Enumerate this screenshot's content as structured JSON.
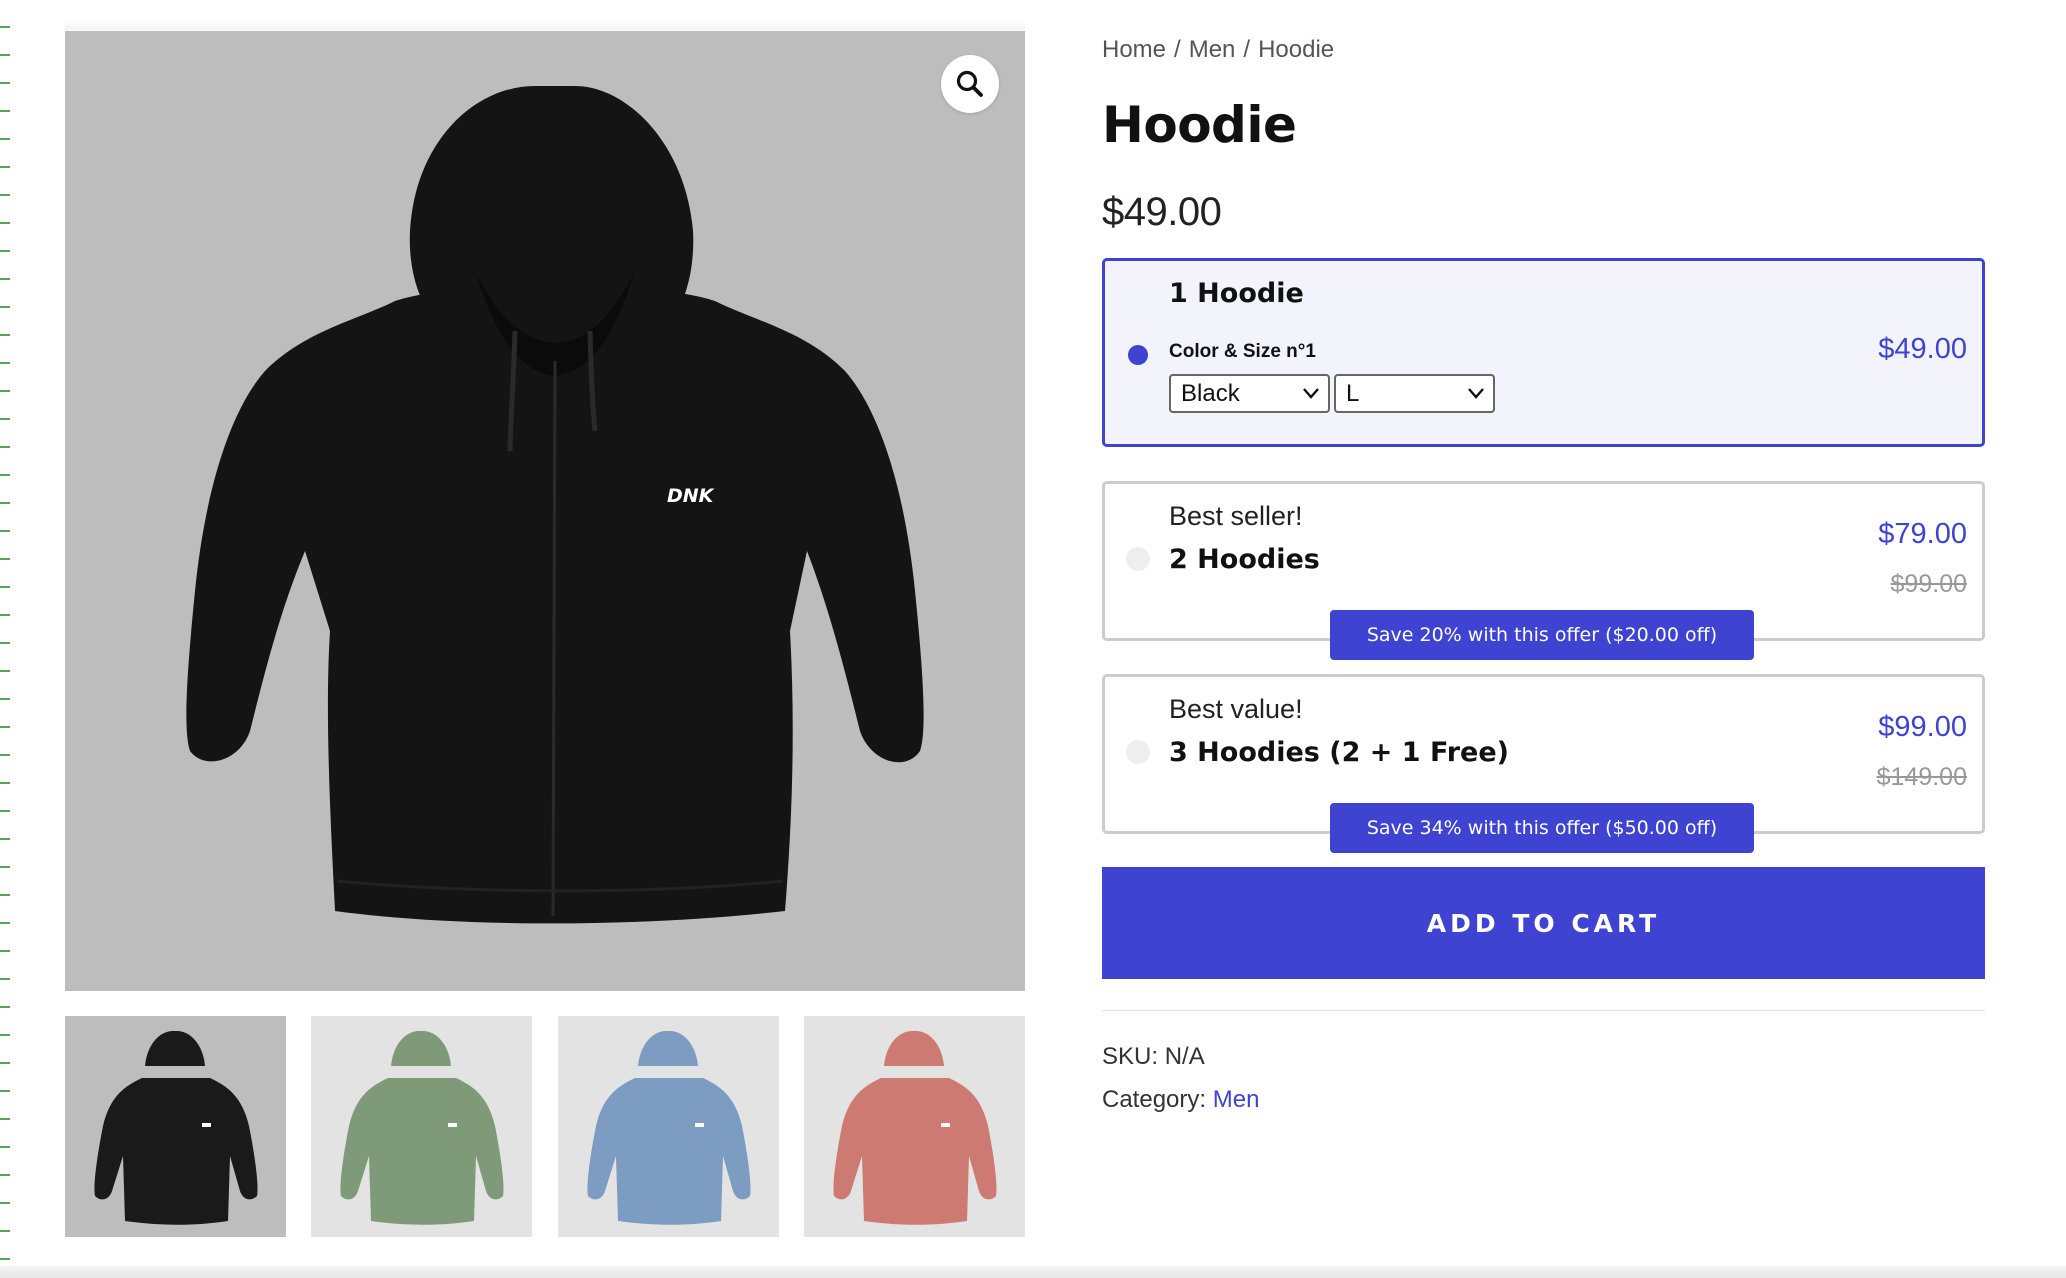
{
  "breadcrumb": {
    "items": [
      "Home",
      "Men",
      "Hoodie"
    ],
    "separator": "/"
  },
  "product": {
    "title": "Hoodie",
    "price": "$49.00"
  },
  "gallery": {
    "main_image": "black hoodie",
    "zoom_icon": "magnifier-icon",
    "thumbnails": [
      {
        "label": "black hoodie",
        "color": "#1a1a1a",
        "bg": "#bdbdbd"
      },
      {
        "label": "green hoodie",
        "color": "#7f9a78",
        "bg": "#e3e3e3"
      },
      {
        "label": "blue hoodie",
        "color": "#7c9cc1",
        "bg": "#e3e3e3"
      },
      {
        "label": "red hoodie",
        "color": "#cc7a72",
        "bg": "#e3e3e3"
      }
    ],
    "logo_text": "DNK"
  },
  "offers": [
    {
      "name": "1 Hoodie",
      "variant_label": "Color & Size n°1",
      "color_select": "Black",
      "size_select": "L",
      "price": "$49.00",
      "selected": true
    },
    {
      "tag": "Best seller!",
      "name": "2 Hoodies",
      "price": "$79.00",
      "old_price": "$99.00",
      "save_text": "Save 20% with this offer ($20.00 off)",
      "selected": false
    },
    {
      "tag": "Best value!",
      "name": "3 Hoodies (2 + 1 Free)",
      "price": "$99.00",
      "old_price": "$149.00",
      "save_text": "Save 34% with this offer ($50.00 off)",
      "selected": false
    }
  ],
  "cart": {
    "add_to_cart_label": "ADD TO CART"
  },
  "meta": {
    "sku_label": "SKU:",
    "sku_value": "N/A",
    "category_label": "Category:",
    "category_value": "Men"
  },
  "colors": {
    "accent": "#3f43d1",
    "border": "#cccccc",
    "selected_bg": "#f3f3fb"
  }
}
